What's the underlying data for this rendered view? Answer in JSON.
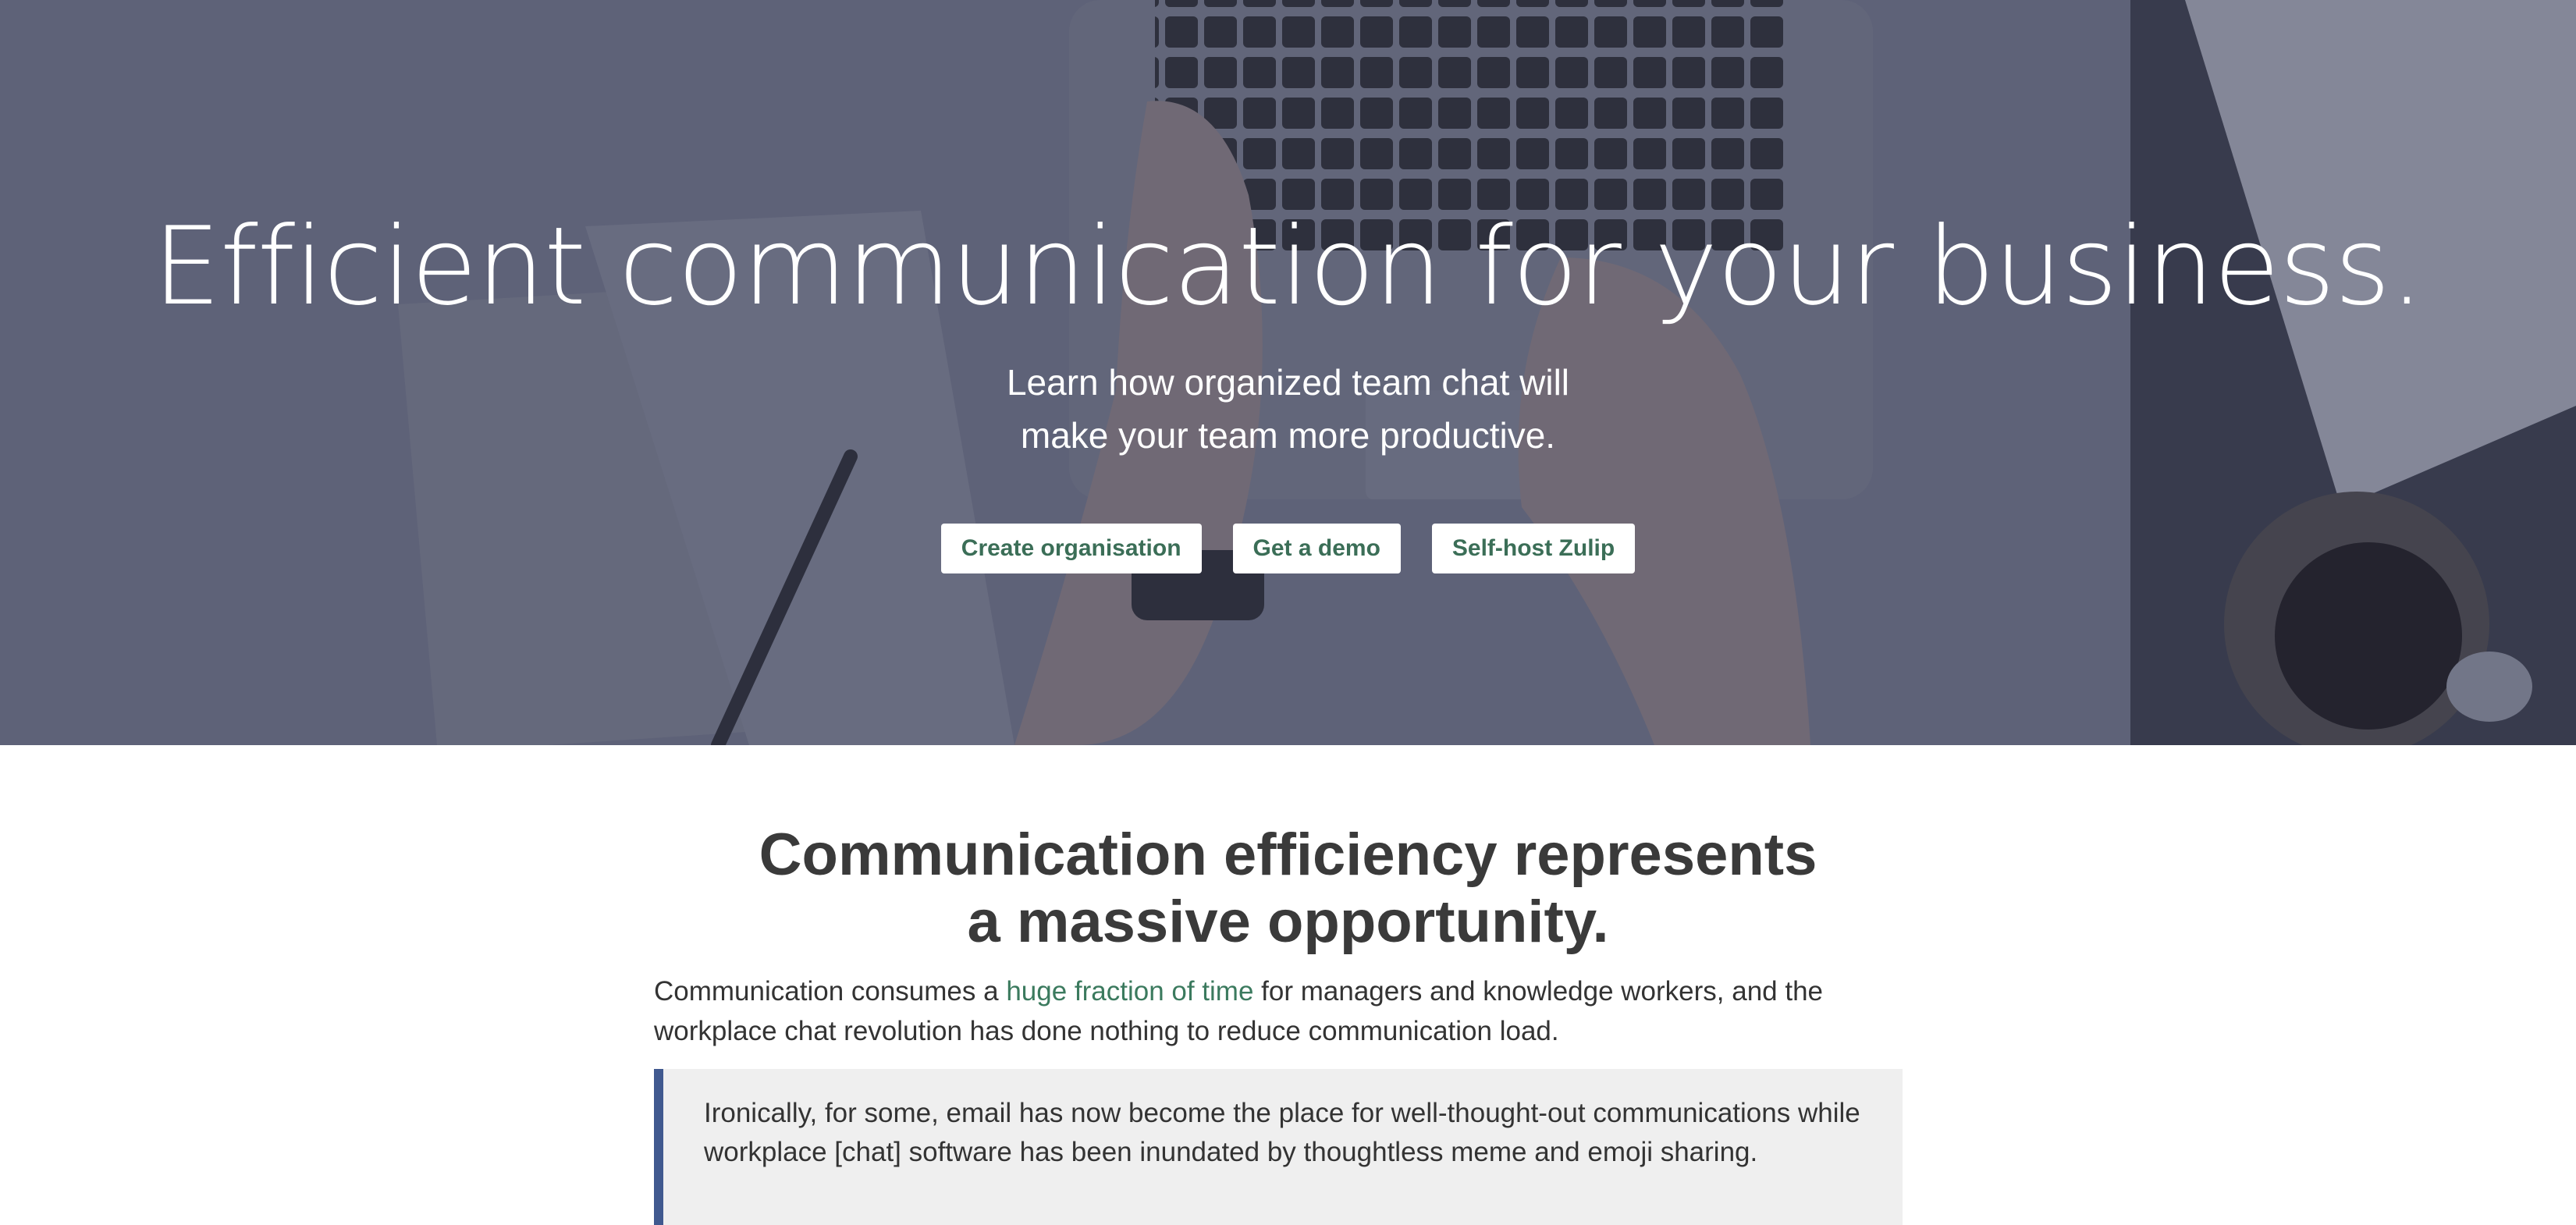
{
  "hero": {
    "title": "Efficient communication for your business.",
    "subtitle_line1": "Learn how organized team chat will",
    "subtitle_line2": "make your team more productive.",
    "buttons": [
      {
        "label": "Create organisation"
      },
      {
        "label": "Get a demo"
      },
      {
        "label": "Self-host Zulip"
      }
    ]
  },
  "section": {
    "title_line1": "Communication efficiency represents",
    "title_line2": "a massive opportunity.",
    "para_before_link": "Communication consumes a ",
    "link_text": "huge fraction of time",
    "para_after_link": " for managers and knowledge workers, and the workplace chat revolution has done nothing to reduce communication load.",
    "quote": "Ironically, for some, email has now become the place for well-thought-out communications while workplace [chat] software has been inundated by thoughtless meme and emoji sharing."
  },
  "colors": {
    "button_text": "#3b6e57",
    "link": "#3b7a5e",
    "quote_border": "#40598f",
    "quote_background": "#efefef",
    "heading": "#3a3a3a"
  }
}
